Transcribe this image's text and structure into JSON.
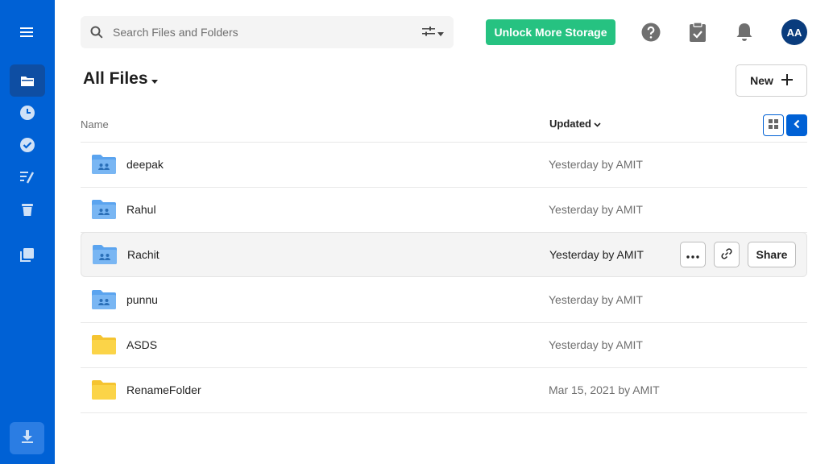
{
  "search": {
    "placeholder": "Search Files and Folders"
  },
  "header": {
    "unlock_label": "Unlock More Storage",
    "avatar_initials": "AA"
  },
  "page": {
    "title": "All Files",
    "new_label": "New"
  },
  "table": {
    "col_name": "Name",
    "col_updated": "Updated",
    "rows": [
      {
        "name": "deepak",
        "updated": "Yesterday by AMIT",
        "type": "shared-folder"
      },
      {
        "name": "Rahul",
        "updated": "Yesterday by AMIT",
        "type": "shared-folder"
      },
      {
        "name": "Rachit",
        "updated": "Yesterday by AMIT",
        "type": "shared-folder"
      },
      {
        "name": "punnu",
        "updated": "Yesterday by AMIT",
        "type": "shared-folder"
      },
      {
        "name": "ASDS",
        "updated": "Yesterday by AMIT",
        "type": "folder"
      },
      {
        "name": "RenameFolder",
        "updated": "Mar 15, 2021 by AMIT",
        "type": "folder"
      }
    ]
  },
  "row_actions": {
    "share_label": "Share"
  },
  "colors": {
    "brand": "#0061d5",
    "accent_green": "#26c281",
    "shared_folder": "#5ba4ef",
    "folder": "#fbd448"
  }
}
